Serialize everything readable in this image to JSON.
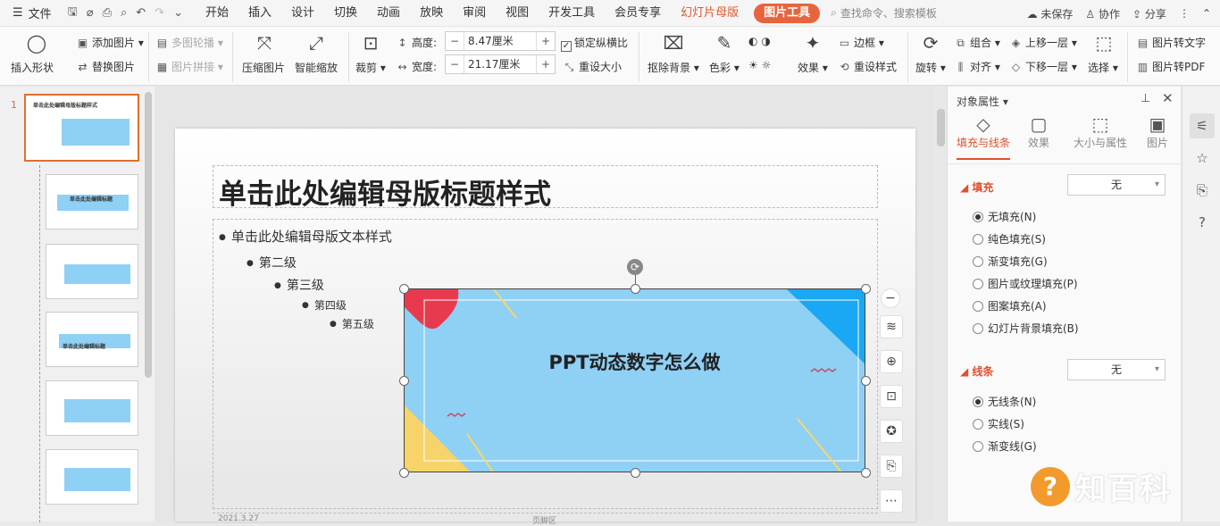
{
  "menubar": {
    "file_label": "文件",
    "tabs": [
      "开始",
      "插入",
      "设计",
      "切换",
      "动画",
      "放映",
      "审阅",
      "视图",
      "开发工具",
      "会员专享"
    ],
    "special_tab": "幻灯片母版",
    "active_tab": "图片工具",
    "search_placeholder": "查找命令、搜索模板",
    "unsaved": "未保存",
    "collab": "协作",
    "share": "分享"
  },
  "ribbon": {
    "insert_shape": "插入形状",
    "add_image": "添加图片",
    "replace_image": "替换图片",
    "multi_outline": "多图轮播",
    "image_collage": "图片拼接",
    "compress": "压缩图片",
    "smart_scale": "智能缩放",
    "crop": "裁剪",
    "height_label": "高度:",
    "height_value": "8.47厘米",
    "width_label": "宽度:",
    "width_value": "21.17厘米",
    "lock_ratio": "锁定纵横比",
    "reset_size": "重设大小",
    "remove_bg": "抠除背景",
    "color": "色彩",
    "effects": "效果",
    "border": "边框",
    "reset_style": "重设样式",
    "rotate": "旋转",
    "group": "组合",
    "align": "对齐",
    "bring_forward": "上移一层",
    "send_backward": "下移一层",
    "select": "选择",
    "img_to_text": "图片转文字",
    "img_to_pdf": "图片转PDF"
  },
  "thumbs": {
    "first_num": "1",
    "items": [
      "单击此处编辑母版标题样式",
      "单击此处编辑标题",
      "",
      "单击此处编辑标题",
      "",
      ""
    ]
  },
  "slide": {
    "title": "单击此处编辑母版标题样式",
    "levels": [
      "单击此处编辑母版文本样式",
      "第二级",
      "第三级",
      "第四级",
      "第五级"
    ],
    "image_title": "PPT动态数字怎么做",
    "footer_date": "2021.3.27",
    "footer_mid": "页脚区"
  },
  "panel": {
    "title": "对象属性",
    "tabs": [
      "填充与线条",
      "效果",
      "大小与属性",
      "图片"
    ],
    "fill_head": "填充",
    "fill_value": "无",
    "fill_options": [
      "无填充(N)",
      "纯色填充(S)",
      "渐变填充(G)",
      "图片或纹理填充(P)",
      "图案填充(A)",
      "幻灯片背景填充(B)"
    ],
    "line_head": "线条",
    "line_value": "无",
    "line_options": [
      "无线条(N)",
      "实线(S)",
      "渐变线(G)"
    ]
  },
  "watermark": {
    "text": "知百科",
    "mark": "?"
  },
  "colors": {
    "accent": "#e0502c",
    "image_bg": "#8fd0f5",
    "red_blob": "#e83a4e",
    "blue_corner": "#1aa7f3",
    "yellow_corner": "#f7d469"
  }
}
